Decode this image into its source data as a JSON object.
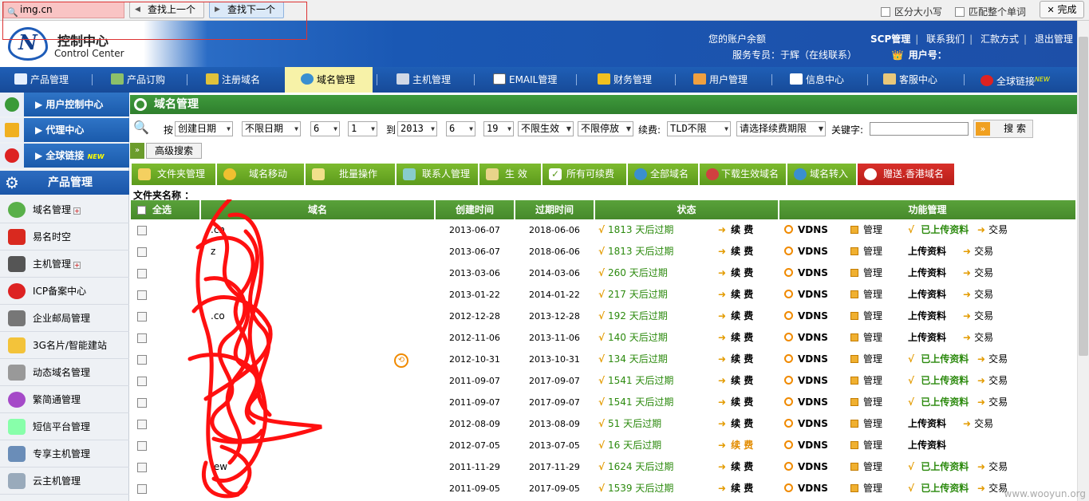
{
  "findbar": {
    "query": "img.cn",
    "prev_label": "查找上一个",
    "next_label": "查找下一个",
    "match_case": "区分大小写",
    "whole_word": "匹配整个单词",
    "done": "完成"
  },
  "header": {
    "title": "控制中心",
    "subtitle": "Control Center",
    "balance_label": "您的账户余额",
    "service_label": "服务专员：于辉（在线联系）",
    "user_label": "用户号：",
    "links": [
      "SCP管理",
      "联系我们",
      "汇款方式",
      "退出管理"
    ]
  },
  "nav": {
    "items": [
      "产品管理",
      "产品订购",
      "注册域名",
      "域名管理",
      "主机管理",
      "EMAIL管理",
      "财务管理",
      "用户管理",
      "信息中心",
      "客服中心",
      "全球链接"
    ],
    "new_badge": "NEW",
    "active": "域名管理"
  },
  "sidebar": {
    "top": [
      "用户控制中心",
      "代理中心",
      "全球链接"
    ],
    "new_badge": "NEW",
    "product_header": "产品管理",
    "items": [
      "域名管理",
      "易名时空",
      "主机管理",
      "ICP备案中心",
      "企业邮局管理",
      "3G名片/智能建站",
      "动态域名管理",
      "繁简通管理",
      "短信平台管理",
      "专享主机管理",
      "云主机管理"
    ]
  },
  "page": {
    "title": "域名管理",
    "filter": {
      "by": "按",
      "sort": "创建日期",
      "date": "不限日期",
      "m1": "6",
      "d1": "1",
      "to": "到",
      "year": "2013",
      "m2": "6",
      "d2": "19",
      "effective": "不限生效",
      "stopped": "不限停放",
      "renew_label": "续费:",
      "tld": "TLD不限",
      "renew_period": "请选择续费期限",
      "keyword_label": "关键字:",
      "search": "搜 索"
    },
    "advanced": "高级搜索",
    "toolbar": [
      "文件夹管理",
      "域名移动",
      "批量操作",
      "联系人管理",
      "生 效",
      "所有可续费",
      "全部域名",
      "下载生效域名",
      "域名转入",
      "赠送.香港域名"
    ],
    "folder_label": "文件夹名称 ："
  },
  "table": {
    "headers": [
      "全选",
      "域名",
      "创建时间",
      "过期时间",
      "状态",
      "功能管理"
    ],
    "renew": "续 费",
    "vdns": "VDNS",
    "manage": "管理",
    "uploaded": "已上传资料",
    "upload": "上传资料",
    "trade": "交易",
    "rows": [
      {
        "domain": ".cn",
        "created": "2013-06-07",
        "expires": "2018-06-06",
        "days": "1813 天后过期",
        "uploaded": true,
        "trade": true,
        "renew_orange": false
      },
      {
        "domain": "z",
        "created": "2013-06-07",
        "expires": "2018-06-06",
        "days": "1813 天后过期",
        "uploaded": false,
        "trade": true,
        "renew_orange": false
      },
      {
        "domain": "",
        "created": "2013-03-06",
        "expires": "2014-03-06",
        "days": "260 天后过期",
        "uploaded": false,
        "trade": true,
        "renew_orange": false
      },
      {
        "domain": "",
        "created": "2013-01-22",
        "expires": "2014-01-22",
        "days": "217 天后过期",
        "uploaded": false,
        "trade": true,
        "renew_orange": false
      },
      {
        "domain": ".co",
        "created": "2012-12-28",
        "expires": "2013-12-28",
        "days": "192 天后过期",
        "uploaded": false,
        "trade": true,
        "renew_orange": false
      },
      {
        "domain": "",
        "created": "2012-11-06",
        "expires": "2013-11-06",
        "days": "140 天后过期",
        "uploaded": false,
        "trade": true,
        "renew_orange": false
      },
      {
        "domain": "",
        "created": "2012-10-31",
        "expires": "2013-10-31",
        "days": "134 天后过期",
        "uploaded": true,
        "trade": true,
        "renew_orange": false
      },
      {
        "domain": "",
        "created": "2011-09-07",
        "expires": "2017-09-07",
        "days": "1541 天后过期",
        "uploaded": true,
        "trade": true,
        "renew_orange": false
      },
      {
        "domain": "",
        "created": "2011-09-07",
        "expires": "2017-09-07",
        "days": "1541 天后过期",
        "uploaded": true,
        "trade": true,
        "renew_orange": false
      },
      {
        "domain": "",
        "created": "2012-08-09",
        "expires": "2013-08-09",
        "days": "51 天后过期",
        "uploaded": false,
        "trade": true,
        "renew_orange": false
      },
      {
        "domain": "",
        "created": "2012-07-05",
        "expires": "2013-07-05",
        "days": "16 天后过期",
        "uploaded": false,
        "trade": false,
        "renew_orange": true
      },
      {
        "domain": ".ew",
        "created": "2011-11-29",
        "expires": "2017-11-29",
        "days": "1624 天后过期",
        "uploaded": true,
        "trade": true,
        "renew_orange": false
      },
      {
        "domain": "",
        "created": "2011-09-05",
        "expires": "2017-09-05",
        "days": "1539 天后过期",
        "uploaded": true,
        "trade": true,
        "renew_orange": false
      }
    ]
  },
  "watermark": "www.wooyun.org",
  "colors": {
    "nav_blue": "#1f5fb6",
    "green": "#4a8f2e",
    "red_scribble": "#ff0000",
    "orange": "#e39b00"
  }
}
